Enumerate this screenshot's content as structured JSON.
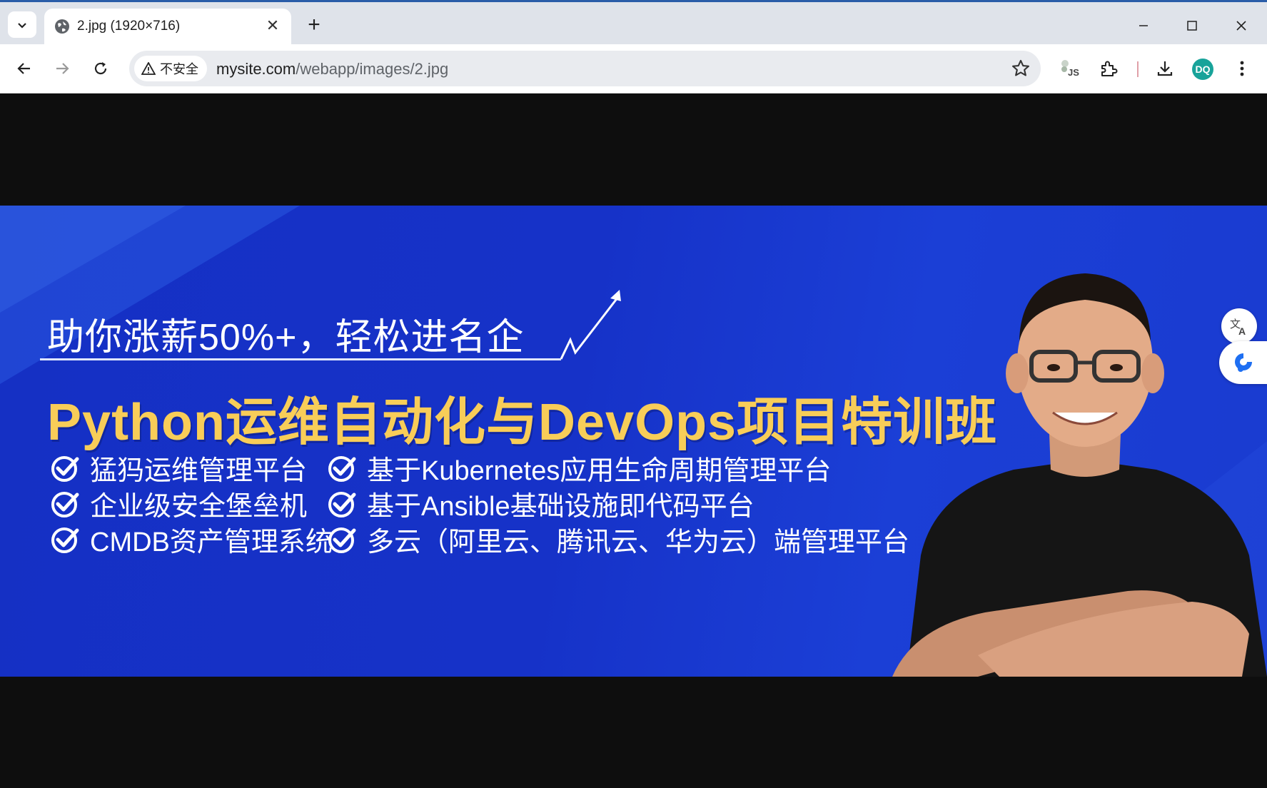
{
  "browser": {
    "tab": {
      "title": "2.jpg (1920×716)",
      "favicon": "globe-icon"
    },
    "address": {
      "security_label": "不安全",
      "url_host": "mysite.com",
      "url_path": "/webapp/images/2.jpg"
    },
    "profile_initials": "DQ",
    "icons": [
      "tab-list-icon",
      "close-icon",
      "plus-icon",
      "minimize-icon",
      "maximize-icon",
      "close-window-icon",
      "back-arrow-icon",
      "forward-arrow-icon",
      "reload-icon",
      "warning-icon",
      "star-icon",
      "js-extension-icon",
      "puzzle-icon",
      "download-icon",
      "more-vert-icon"
    ]
  },
  "banner": {
    "headline": "助你涨薪50%+，轻松进名企",
    "title": "Python运维自动化与DevOps项目特训班",
    "features_left": [
      "猛犸运维管理平台",
      "企业级安全堡垒机",
      "CMDB资产管理系统"
    ],
    "features_right": [
      "基于Kubernetes应用生命周期管理平台",
      "基于Ansible基础设施即代码平台",
      "多云（阿里云、腾讯云、华为云）端管理平台"
    ],
    "colors": {
      "background": "#1632c8",
      "title": "#f8cd58",
      "text": "#ffffff"
    }
  },
  "side_tools": [
    "translate-icon",
    "assistant-icon"
  ]
}
